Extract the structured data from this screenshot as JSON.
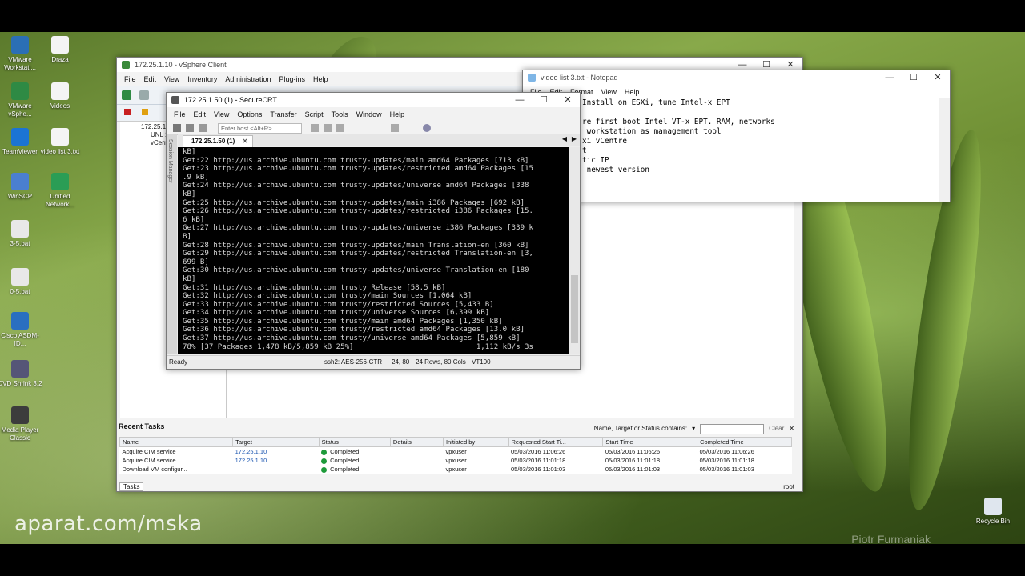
{
  "desktop": {
    "icons": [
      {
        "label": "VMware Workstati...",
        "color": "#2b6fb5"
      },
      {
        "label": "Draza",
        "color": "#f4f4f4"
      },
      {
        "label": "VMware vSphe...",
        "color": "#2e8a44"
      },
      {
        "label": "Videos",
        "color": "#f4f4f4"
      },
      {
        "label": "TeamViewer",
        "color": "#1b74d4"
      },
      {
        "label": "video list 3.txt",
        "color": "#f4f4f4"
      },
      {
        "label": "WinSCP",
        "color": "#4a7fd0"
      },
      {
        "label": "Unified Network...",
        "color": "#2a9d55"
      },
      {
        "label": "3-5.bat",
        "color": "#e8e8e8"
      },
      {
        "label": "0-5.bat",
        "color": "#e8e8e8"
      },
      {
        "label": "Cisco ASDM-ID...",
        "color": "#2a6fc0"
      },
      {
        "label": "DVD Shrink 3.2",
        "color": "#555577"
      },
      {
        "label": "Media Player Classic",
        "color": "#3c3c3c"
      }
    ],
    "recycle_bin": "Recycle Bin",
    "watermark": "aparat.com/mska",
    "author": "Piotr Furmaniak"
  },
  "vsphere": {
    "title": "172.25.1.10 - vSphere Client",
    "menu": [
      "File",
      "Edit",
      "View",
      "Inventory",
      "Administration",
      "Plug-ins",
      "Help"
    ],
    "tree": [
      "172.25.1.10",
      "UNL 1",
      "vCenter"
    ],
    "recent_tasks": {
      "title": "Recent Tasks",
      "filter_label": "Name, Target or Status contains:",
      "clear": "Clear",
      "columns": [
        "Name",
        "Target",
        "Status",
        "Details",
        "Initiated by",
        "Requested Start Ti...",
        "Start Time",
        "Completed Time"
      ],
      "rows": [
        {
          "name": "Acquire CIM service",
          "target": "172.25.1.10",
          "status": "Completed",
          "details": "",
          "by": "vpxuser",
          "req": "05/03/2016 11:06:26",
          "start": "05/03/2016 11:06:26",
          "done": "05/03/2016 11:06:26"
        },
        {
          "name": "Acquire CIM service",
          "target": "172.25.1.10",
          "status": "Completed",
          "details": "",
          "by": "vpxuser",
          "req": "05/03/2016 11:01:18",
          "start": "05/03/2016 11:01:18",
          "done": "05/03/2016 11:01:18"
        },
        {
          "name": "Download VM configur...",
          "target": "",
          "status": "Completed",
          "details": "",
          "by": "vpxuser",
          "req": "05/03/2016 11:01:03",
          "start": "05/03/2016 11:01:03",
          "done": "05/03/2016 11:01:03"
        }
      ]
    },
    "tasks_tab": "Tasks",
    "user": "root"
  },
  "notepad": {
    "title": "video list 3.txt - Notepad",
    "menu": [
      "File",
      "Edit",
      "Format",
      "View",
      "Help"
    ],
    "lines": [
      "Install on ESXi, tune Intel-x EPT",
      "",
      "re first boot Intel VT-x EPT. RAM, networks",
      " workstation as management tool",
      "xi vCentre",
      "t",
      "tic IP",
      " newest version"
    ]
  },
  "securecrt": {
    "title": "172.25.1.50 (1) - SecureCRT",
    "menu": [
      "File",
      "Edit",
      "View",
      "Options",
      "Transfer",
      "Script",
      "Tools",
      "Window",
      "Help"
    ],
    "host_placeholder": "Enter host <Alt+R>",
    "session_manager": "Session Manager",
    "tab": "172.25.1.50 (1)",
    "terminal": [
      "kB]",
      "Get:22 http://us.archive.ubuntu.com trusty-updates/main amd64 Packages [713 kB]",
      "Get:23 http://us.archive.ubuntu.com trusty-updates/restricted amd64 Packages [15",
      ".9 kB]",
      "Get:24 http://us.archive.ubuntu.com trusty-updates/universe amd64 Packages [338",
      "kB]",
      "Get:25 http://us.archive.ubuntu.com trusty-updates/main i386 Packages [692 kB]",
      "Get:26 http://us.archive.ubuntu.com trusty-updates/restricted i386 Packages [15.",
      "6 kB]",
      "Get:27 http://us.archive.ubuntu.com trusty-updates/universe i386 Packages [339 k",
      "B]",
      "Get:28 http://us.archive.ubuntu.com trusty-updates/main Translation-en [360 kB]",
      "Get:29 http://us.archive.ubuntu.com trusty-updates/restricted Translation-en [3,",
      "699 B]",
      "Get:30 http://us.archive.ubuntu.com trusty-updates/universe Translation-en [180",
      "kB]",
      "Get:31 http://us.archive.ubuntu.com trusty Release [58.5 kB]",
      "Get:32 http://us.archive.ubuntu.com trusty/main Sources [1,064 kB]",
      "Get:33 http://us.archive.ubuntu.com trusty/restricted Sources [5,433 B]",
      "Get:34 http://us.archive.ubuntu.com trusty/universe Sources [6,399 kB]",
      "Get:35 http://us.archive.ubuntu.com trusty/main amd64 Packages [1,350 kB]",
      "Get:36 http://us.archive.ubuntu.com trusty/restricted amd64 Packages [13.0 kB]",
      "Get:37 http://us.archive.ubuntu.com trusty/universe amd64 Packages [5,859 kB]",
      "78% [37 Packages 1,478 kB/5,859 kB 25%]                            1,112 kB/s 3s"
    ],
    "status": {
      "ready": "Ready",
      "cipher": "ssh2: AES-256-CTR",
      "cursor": "24, 80",
      "size": "24 Rows, 80 Cols",
      "emulation": "VT100"
    }
  }
}
